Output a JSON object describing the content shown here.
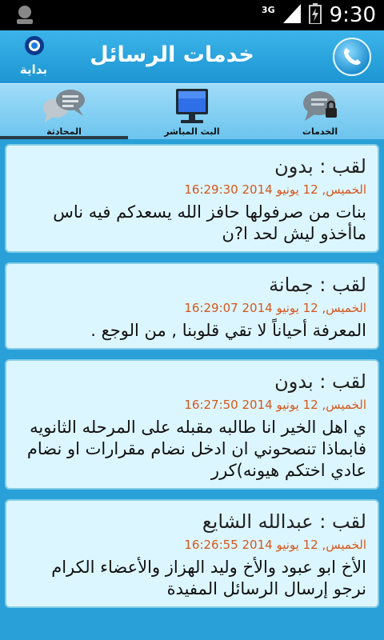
{
  "status_bar": {
    "time": "9:30",
    "network": "3G"
  },
  "header": {
    "brand": "بداية",
    "title": "خدمات الرسائل"
  },
  "tabs": [
    {
      "label": "الخدمات"
    },
    {
      "label": "البث المباشر"
    },
    {
      "label": "المحادثة"
    }
  ],
  "messages": [
    {
      "title": "لقب : بدون",
      "date": "الخميس, 12 يونيو 2014 16:29:30",
      "text": "بنات من صرفولها حافز الله يسعدكم فيه ناس ماأخذو ليش لحد ا?ن"
    },
    {
      "title": "لقب : جمانة",
      "date": "الخميس, 12 يونيو 2014 16:29:07",
      "text": "المعرفة أحياناً لا تقي قلوبنا , من الوجع ."
    },
    {
      "title": "لقب : بدون",
      "date": "الخميس, 12 يونيو 2014 16:27:50",
      "text": "ي اهل الخير انا طالبه مقبله على المرحله الثانويه فابماذا تنصحوني ان ادخل نضام مقرارات او نضام عادي اختكم هيونه)كرر"
    },
    {
      "title": "لقب : عبدالله الشايع",
      "date": "الخميس, 12 يونيو 2014 16:26:55",
      "text": "الأخ ابو عبود والأخ وليد الهزاز والأعضاء الكرام نرجو إرسال الرسائل المفيدة"
    }
  ]
}
